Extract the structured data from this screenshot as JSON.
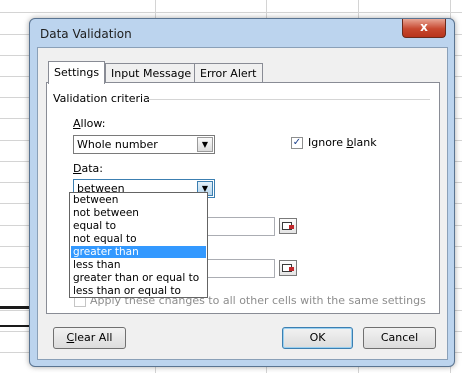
{
  "dialog": {
    "title": "Data Validation",
    "close_glyph": "x"
  },
  "tabs": [
    {
      "label": "Settings",
      "active": true
    },
    {
      "label": "Input Message",
      "active": false
    },
    {
      "label": "Error Alert",
      "active": false
    }
  ],
  "settings": {
    "group_label": "Validation criteria",
    "allow_label_pre": "",
    "allow_label_key": "A",
    "allow_label_post": "llow:",
    "allow_value": "Whole number",
    "ignore_blank_pre": "Ignore ",
    "ignore_blank_key": "b",
    "ignore_blank_post": "lank",
    "ignore_blank_checked": true,
    "data_label_key": "D",
    "data_label_post": "ata:",
    "data_value": "between",
    "apply_all_text": "Apply these changes to all other cells with the same settings",
    "apply_all_checked": false
  },
  "data_options": [
    "between",
    "not between",
    "equal to",
    "not equal to",
    "greater than",
    "less than",
    "greater than or equal to",
    "less than or equal to"
  ],
  "data_options_highlighted": "greater than",
  "buttons": {
    "clear_key": "C",
    "clear_post": "lear All",
    "ok": "OK",
    "cancel": "Cancel"
  },
  "colors": {
    "frame": "#bcd4ee",
    "close_red": "#c7482f",
    "selection": "#3399ff"
  }
}
